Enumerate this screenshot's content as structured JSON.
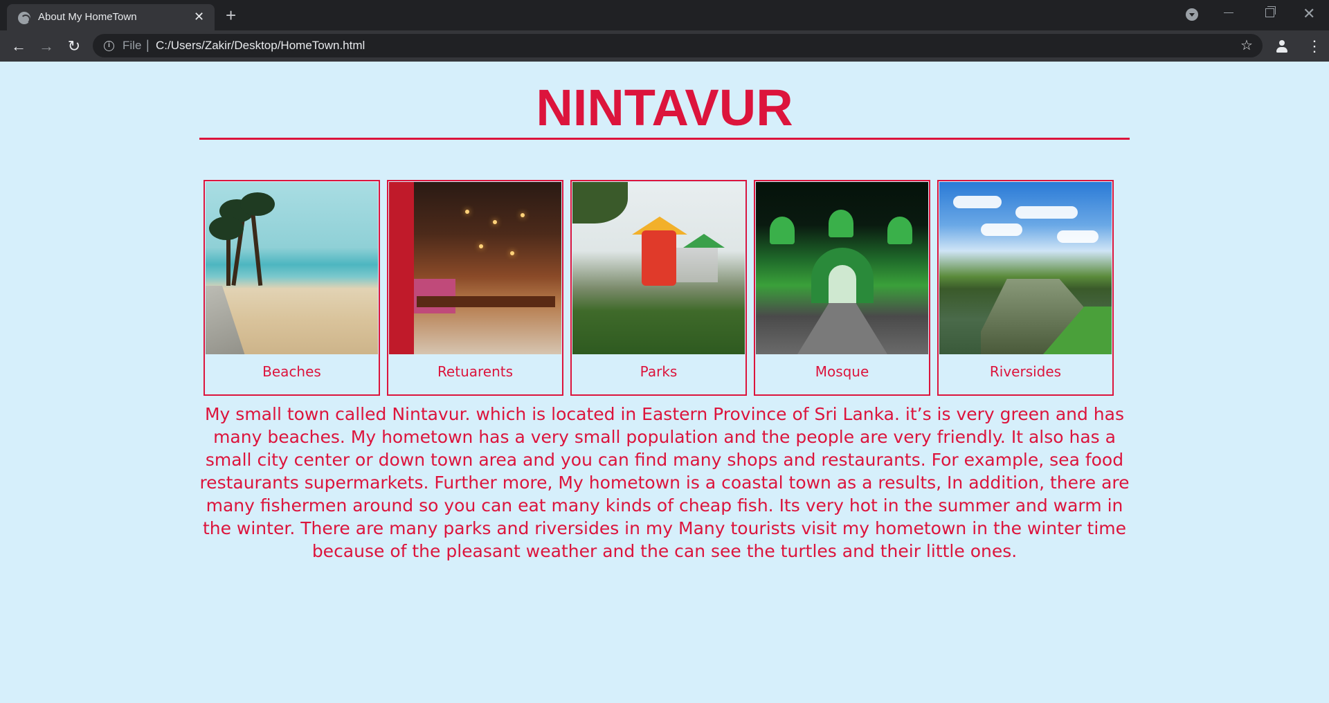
{
  "browser": {
    "tab_title": "About My HomeTown",
    "tab_close": "✕",
    "new_tab": "+",
    "scheme_label": "File",
    "separator": "|",
    "url": "C:/Users/Zakir/Desktop/HomeTown.html",
    "icons": {
      "back": "arrow-left-icon",
      "forward": "arrow-right-icon",
      "reload": "reload-icon",
      "info": "info-icon",
      "star": "star-icon",
      "profile": "profile-icon",
      "menu": "kebab-menu-icon"
    }
  },
  "page": {
    "title": "NINTAVUR",
    "gallery": [
      {
        "caption": "Beaches",
        "image": "beach-image"
      },
      {
        "caption": "Retuarents",
        "image": "restaurant-image"
      },
      {
        "caption": "Parks",
        "image": "park-image"
      },
      {
        "caption": "Mosque",
        "image": "mosque-image"
      },
      {
        "caption": "Riversides",
        "image": "riverside-image"
      }
    ],
    "description": "My small town called Nintavur. which is located in Eastern Province of Sri Lanka. it’s is very green and has many beaches. My hometown has a very small population and the people are very friendly. It also has a small city center or down town area and you can find many shops and restaurants. For example, sea food restaurants supermarkets. Further more, My hometown is a coastal town as a results, In addition, there are many fishermen around so you can eat many kinds of cheap fish. Its very hot in the summer and warm in the winter. There are many parks and riversides in my Many tourists visit my hometown in the winter time because of the pleasant weather and the can see the turtles and their little ones."
  },
  "colors": {
    "accent": "#dc143c",
    "page_background": "#d6effb",
    "browser_frame": "#202124",
    "browser_toolbar": "#35363a"
  }
}
